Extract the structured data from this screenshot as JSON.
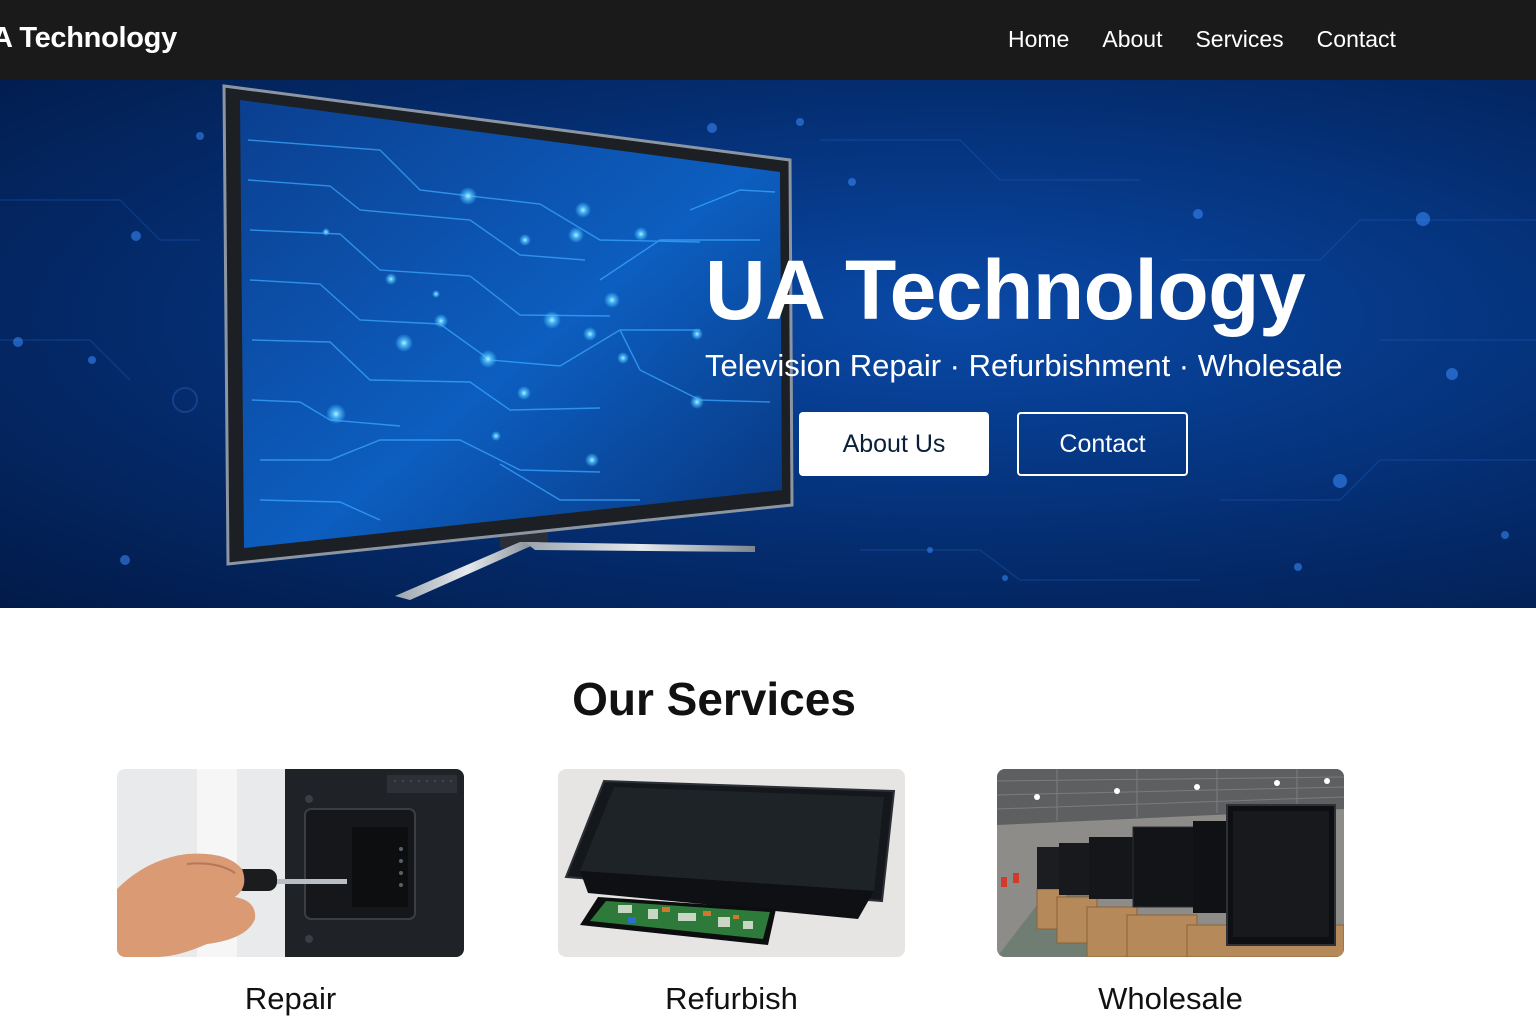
{
  "nav": {
    "brand": "A Technology",
    "links": [
      "Home",
      "About",
      "Services",
      "Contact"
    ]
  },
  "hero": {
    "title": "UA Technology",
    "subtitle": "Television Repair · Refurbishment · Wholesale",
    "primary_button": "About Us",
    "secondary_button": "Contact"
  },
  "services": {
    "heading": "Our Services",
    "cards": [
      {
        "label": "Repair",
        "image": "tv-repair-screwdriver-image"
      },
      {
        "label": "Refurbish",
        "image": "tv-refurbish-circuit-board-image"
      },
      {
        "label": "Wholesale",
        "image": "tv-warehouse-stock-image"
      }
    ]
  },
  "colors": {
    "nav_background": "#1a1a1a",
    "hero_blue": "#063a8a",
    "circuit_glow": "#4fc3ff",
    "text_dark": "#111111"
  }
}
